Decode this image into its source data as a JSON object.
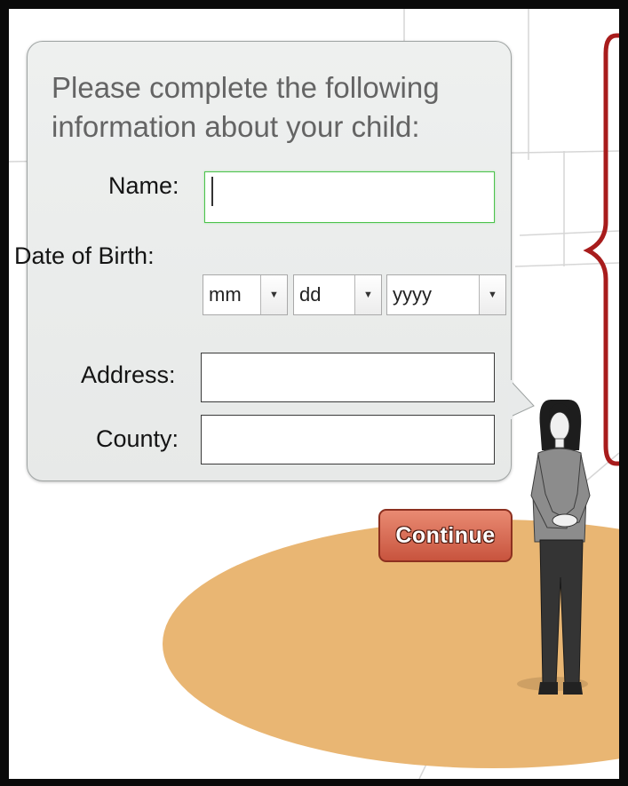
{
  "form": {
    "prompt": "Please complete the following information about your child:",
    "name": {
      "label": "Name:",
      "value": ""
    },
    "date_of_birth": {
      "label": "Date of Birth:",
      "month": "mm",
      "day": "dd",
      "year": "yyyy"
    },
    "address": {
      "label": "Address:",
      "value": ""
    },
    "county": {
      "label": "County:",
      "value": ""
    },
    "arrow_glyph": "▼"
  },
  "continue_button": {
    "label": "Continue"
  },
  "colors": {
    "floor": "#e9b673",
    "button": "#d0614a",
    "bracket": "#a81c1c",
    "focus_border": "#4cc24c"
  }
}
